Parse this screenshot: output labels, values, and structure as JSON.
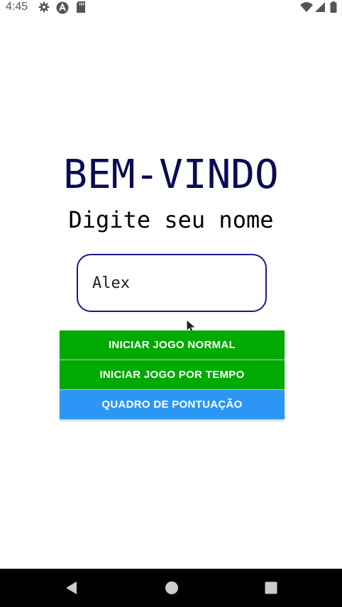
{
  "status_bar": {
    "time": "4:45",
    "icons": [
      "gear-icon",
      "app-icon",
      "sd-card-icon",
      "wifi-icon",
      "signal-icon",
      "battery-icon"
    ]
  },
  "main": {
    "title": "BEM-VINDO",
    "subtitle": "Digite seu nome",
    "name_input": {
      "value": "Alex",
      "placeholder": ""
    },
    "buttons": [
      {
        "label": "INICIAR JOGO NORMAL",
        "color": "#00aa00"
      },
      {
        "label": "INICIAR JOGO POR TEMPO",
        "color": "#00aa00"
      },
      {
        "label": "QUADRO DE PONTUAÇÃO",
        "color": "#2b96f3"
      }
    ]
  },
  "nav_bar": {
    "icons": [
      "back-icon",
      "home-icon",
      "recents-icon"
    ]
  },
  "colors": {
    "title": "#0a0a55",
    "input_border": "#1a1a8a",
    "primary_green": "#00aa00",
    "scoreboard_blue": "#2b96f3"
  }
}
